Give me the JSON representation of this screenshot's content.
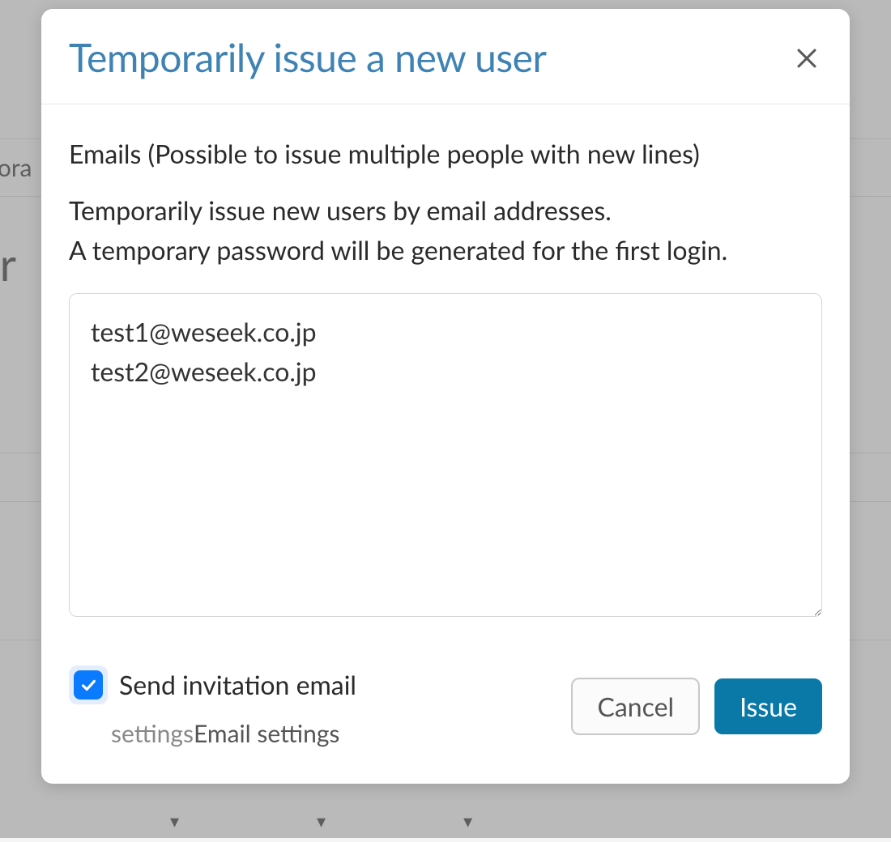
{
  "background": {
    "tab_fragment": "pora",
    "heading_fragment": "er"
  },
  "modal": {
    "title": "Temporarily issue a new user",
    "emails_label": "Emails (Possible to issue multiple people with new lines)",
    "help_text": "Temporarily issue new users by email addresses.\nA temporary password will be generated for the first login.",
    "textarea_value": "test1@weseek.co.jp\ntest2@weseek.co.jp",
    "checkbox": {
      "checked": true,
      "label": "Send invitation email"
    },
    "settings_prefix": "settings",
    "settings_link": "Email settings",
    "buttons": {
      "cancel": "Cancel",
      "issue": "Issue"
    }
  }
}
